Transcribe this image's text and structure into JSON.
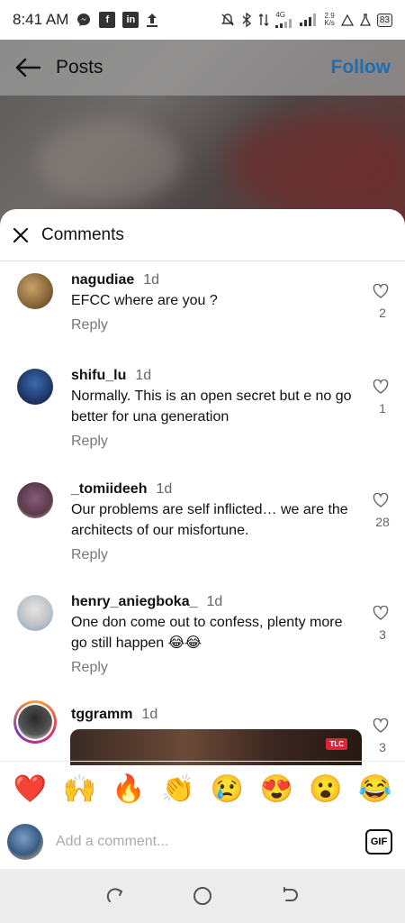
{
  "status_bar": {
    "time": "8:41 AM",
    "left_icons": [
      "messenger-icon",
      "facebook-icon",
      "linkedin-icon",
      "upload-icon"
    ],
    "network_type": "4G",
    "net_speed_value": "2.9",
    "net_speed_unit": "K/s",
    "battery": "83"
  },
  "header": {
    "title": "Posts",
    "follow_label": "Follow",
    "follow_color": "#1f6fb0"
  },
  "sheet": {
    "title": "Comments"
  },
  "comments": [
    {
      "username": "nagudiae",
      "time": "1d",
      "text": "EFCC where are you ?",
      "reply_label": "Reply",
      "likes": "2"
    },
    {
      "username": "shifu_lu",
      "time": "1d",
      "text": "Normally. This is an open secret but e no go better for una generation",
      "reply_label": "Reply",
      "likes": "1"
    },
    {
      "username": "_tomiideeh",
      "time": "1d",
      "text": "Our problems are self inflicted… we are the architects of our misfortune.",
      "reply_label": "Reply",
      "likes": "28"
    },
    {
      "username": "henry_aniegboka_",
      "time": "1d",
      "text": "One don come out to confess, plenty more go still happen 😂😂",
      "reply_label": "Reply",
      "likes": "3"
    },
    {
      "username": "tggramm",
      "time": "1d",
      "text": "",
      "reply_label": "",
      "likes": "3",
      "media_badge": "TLC"
    }
  ],
  "reactions": [
    "❤️",
    "🙌",
    "🔥",
    "👏",
    "😢",
    "😍",
    "😮",
    "😂"
  ],
  "composer": {
    "placeholder": "Add a comment...",
    "gif_label": "GIF"
  }
}
